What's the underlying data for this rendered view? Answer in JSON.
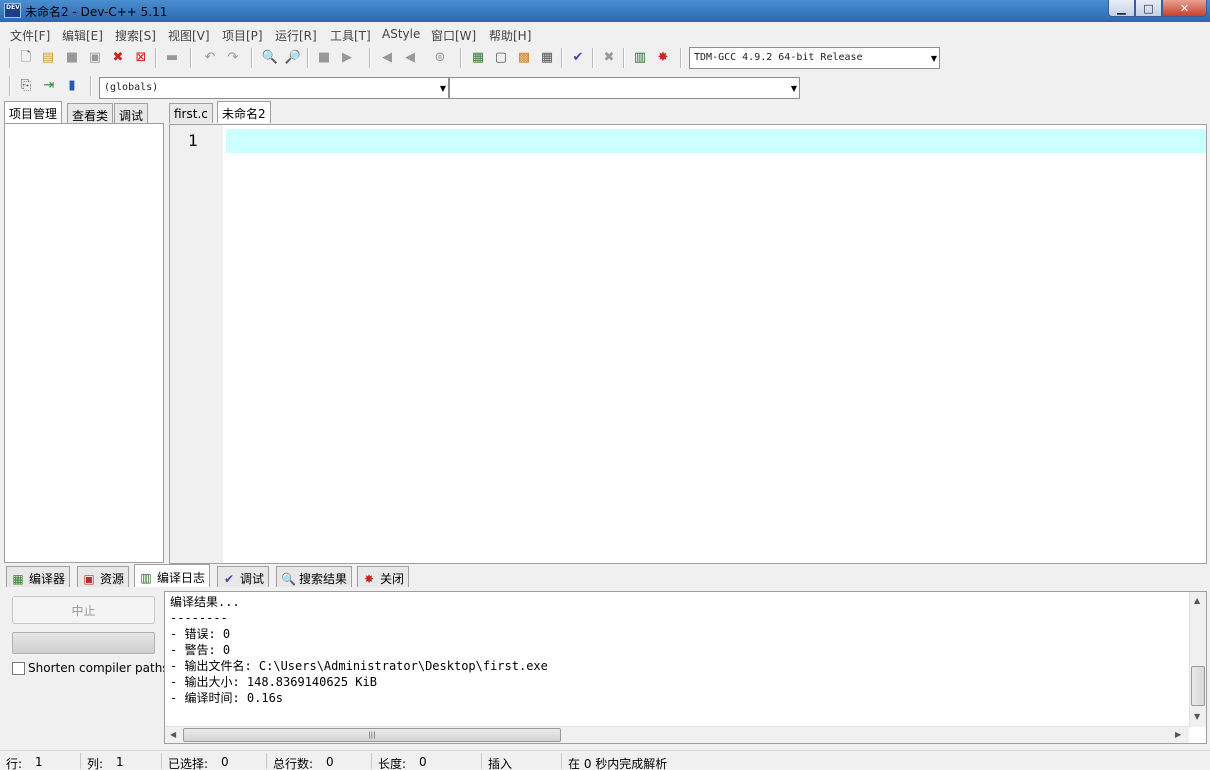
{
  "window": {
    "title": "未命名2 - Dev-C++ 5.11",
    "app_icon_text": "DEV"
  },
  "menu": [
    "文件[F]",
    "编辑[E]",
    "搜索[S]",
    "视图[V]",
    "项目[P]",
    "运行[R]",
    "工具[T]",
    "AStyle",
    "窗口[W]",
    "帮助[H]"
  ],
  "toolbar": {
    "compiler_select": "TDM-GCC 4.9.2 64-bit Release",
    "scope_select": "(globals)",
    "member_select": "",
    "icons": [
      "new-file-icon",
      "open-file-icon",
      "save-icon",
      "save-all-icon",
      "close-file-icon",
      "close-all-icon",
      "print-icon",
      "undo-icon",
      "redo-icon",
      "find-icon",
      "replace-icon",
      "back-icon",
      "forward-icon",
      "indent-icon",
      "unindent-icon",
      "toggle-comment-icon",
      "compile-icon",
      "run-icon",
      "compile-run-icon",
      "rebuild-icon",
      "syntax-check-icon",
      "abort-icon",
      "profile-icon",
      "delete-profile-icon",
      "new-project-icon",
      "add-to-project-icon",
      "remove-from-project-icon"
    ]
  },
  "left_tabs": [
    "项目管理",
    "查看类",
    "调试"
  ],
  "editor_tabs": [
    "first.c",
    "未命名2"
  ],
  "editor": {
    "line_number": "1",
    "highlight_color": "#ccffff"
  },
  "bottom_tabs": [
    "编译器",
    "资源",
    "编译日志",
    "调试",
    "搜索结果",
    "关闭"
  ],
  "compile_panel": {
    "stop_label": "中止",
    "shorten_label": "Shorten compiler paths",
    "log": [
      "编译结果...",
      "--------",
      "- 错误: 0",
      "- 警告: 0",
      "- 输出文件名: C:\\Users\\Administrator\\Desktop\\first.exe",
      "- 输出大小: 148.8369140625 KiB",
      "- 编译时间: 0.16s"
    ]
  },
  "status": {
    "row_label": "行:",
    "row": "1",
    "col_label": "列:",
    "col": "1",
    "sel_label": "已选择:",
    "sel": "0",
    "lines_label": "总行数:",
    "lines": "0",
    "len_label": "长度:",
    "len": "0",
    "mode": "插入",
    "parse": "在 0 秒内完成解析"
  }
}
